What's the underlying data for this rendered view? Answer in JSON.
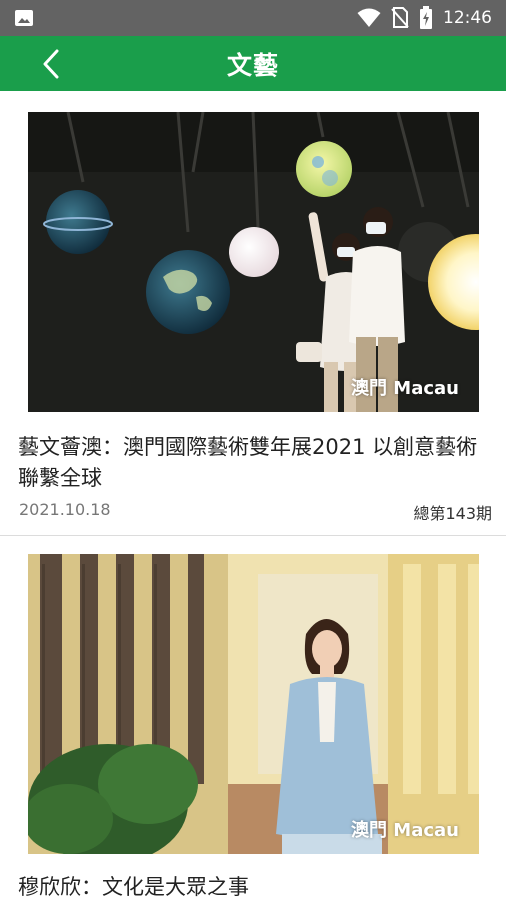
{
  "status_bar": {
    "time": "12:46",
    "icons": [
      "image-icon",
      "wifi-icon",
      "no-sim-icon",
      "battery-charging-icon"
    ]
  },
  "app_bar": {
    "title": "文藝",
    "back_icon": "chevron-left-icon"
  },
  "colors": {
    "app_bar": "#1a9e4b",
    "status_bar": "#636363"
  },
  "articles": [
    {
      "image_watermark": "澳門 Macau",
      "headline": "藝文薈澳：澳門國際藝術雙年展2021 以創意藝術聯繫全球",
      "date": "2021.10.18",
      "issue": "總第143期"
    },
    {
      "image_watermark": "澳門 Macau",
      "headline": "穆欣欣：文化是大眾之事"
    }
  ]
}
